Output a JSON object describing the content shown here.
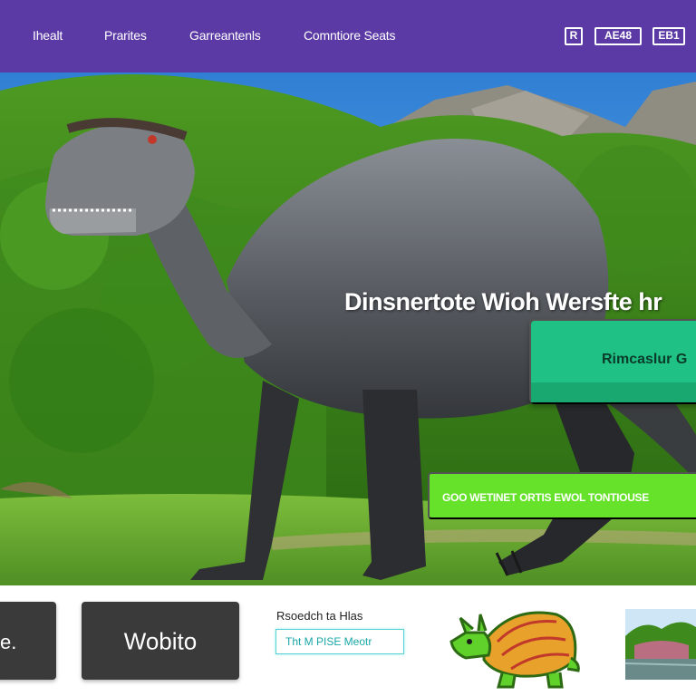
{
  "nav": {
    "items": [
      "Ihealt",
      "Prarites",
      "Garreantenls",
      "Comntiore Seats"
    ],
    "icons": [
      {
        "name": "r-logo-icon",
        "text": "R"
      },
      {
        "name": "language-badge",
        "text": "AE48"
      },
      {
        "name": "account-badge",
        "text": "EB1"
      }
    ]
  },
  "hero": {
    "title": "Dinsnertote Wioh Wersfte hr",
    "primary_cta": "Rimcaslur G",
    "secondary_cta": "GOO WETINET ORTIS EWOL TONTIOUSE"
  },
  "bottom": {
    "card_small_label": "e.",
    "card_main_label": "Wobito",
    "promo_heading": "Rsoedch ta Hlas",
    "promo_box": "Tht M PISE Meotr"
  },
  "colors": {
    "nav_bg": "#5b3aa6",
    "primary_cta": "#1fc184",
    "secondary_cta": "#66e22a",
    "card_dark": "#3a3a3a"
  }
}
